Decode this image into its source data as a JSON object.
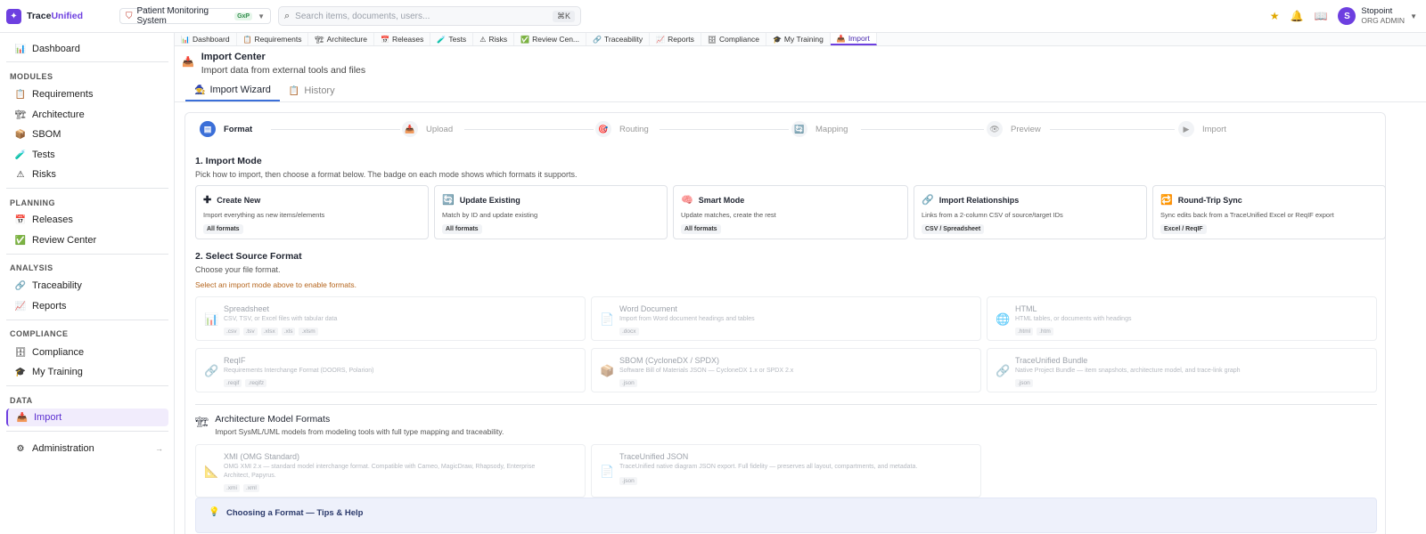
{
  "app": {
    "brand_prefix": "Trace",
    "brand_suffix": "Unified",
    "project": "Patient Monitoring System",
    "project_badge": "GxP",
    "search_placeholder": "Search items, documents, users...",
    "search_shortcut": "⌘K",
    "user_initial": "S",
    "user_name": "Stopoint",
    "user_role": "ORG ADMIN"
  },
  "sidebar": {
    "dashboard": "Dashboard",
    "sections": {
      "modules": "MODULES",
      "planning": "PLANNING",
      "analysis": "ANALYSIS",
      "compliance": "COMPLIANCE",
      "data": "DATA"
    },
    "items": {
      "requirements": "Requirements",
      "architecture": "Architecture",
      "sbom": "SBOM",
      "tests": "Tests",
      "risks": "Risks",
      "releases": "Releases",
      "review_center": "Review Center",
      "traceability": "Traceability",
      "reports": "Reports",
      "compliance": "Compliance",
      "my_training": "My Training",
      "import": "Import",
      "administration": "Administration"
    }
  },
  "tabs": [
    "Dashboard",
    "Requirements",
    "Architecture",
    "Releases",
    "Tests",
    "Risks",
    "Review Cen...",
    "Traceability",
    "Reports",
    "Compliance",
    "My Training",
    "Import"
  ],
  "page": {
    "title": "Import Center",
    "subtitle": "Import data from external tools and files",
    "subtabs": {
      "wizard": "Import Wizard",
      "history": "History"
    }
  },
  "stepper": [
    "Format",
    "Upload",
    "Routing",
    "Mapping",
    "Preview",
    "Import"
  ],
  "mode_section": {
    "title": "1. Import Mode",
    "subtitle": "Pick how to import, then choose a format below. The badge on each mode shows which formats it supports."
  },
  "modes": [
    {
      "title": "Create New",
      "desc": "Import everything as new items/elements",
      "badge": "All formats"
    },
    {
      "title": "Update Existing",
      "desc": "Match by ID and update existing",
      "badge": "All formats"
    },
    {
      "title": "Smart Mode",
      "desc": "Update matches, create the rest",
      "badge": "All formats"
    },
    {
      "title": "Import Relationships",
      "desc": "Links from a 2-column CSV of source/target IDs",
      "badge": "CSV / Spreadsheet"
    },
    {
      "title": "Round-Trip Sync",
      "desc": "Sync edits back from a TraceUnified Excel or ReqIF export",
      "badge": "Excel / ReqIF"
    }
  ],
  "format_section": {
    "title": "2. Select Source Format",
    "subtitle": "Choose your file format.",
    "warning": "Select an import mode above to enable formats."
  },
  "formats": [
    {
      "title": "Spreadsheet",
      "desc": "CSV, TSV, or Excel files with tabular data",
      "exts": [
        ".csv",
        ".tsv",
        ".xlsx",
        ".xls",
        ".xlsm"
      ]
    },
    {
      "title": "Word Document",
      "desc": "Import from Word document headings and tables",
      "exts": [
        ".docx"
      ]
    },
    {
      "title": "HTML",
      "desc": "HTML tables, or documents with headings",
      "exts": [
        ".html",
        ".htm"
      ]
    },
    {
      "title": "ReqIF",
      "desc": "Requirements Interchange Format (DOORS, Polarion)",
      "exts": [
        ".reqif",
        ".reqifz"
      ]
    },
    {
      "title": "SBOM (CycloneDX / SPDX)",
      "desc": "Software Bill of Materials JSON — CycloneDX 1.x or SPDX 2.x",
      "exts": [
        ".json"
      ]
    },
    {
      "title": "TraceUnified Bundle",
      "desc": "Native Project Bundle — item snapshots, architecture model, and trace-link graph",
      "exts": [
        ".json"
      ]
    }
  ],
  "arch_section": {
    "title": "Architecture Model Formats",
    "subtitle": "Import SysML/UML models from modeling tools with full type mapping and traceability."
  },
  "arch_formats": [
    {
      "title": "XMI (OMG Standard)",
      "desc1": "OMG XMI 2.x — standard model interchange format. Compatible with Cameo, MagicDraw, Rhapsody, Enterprise",
      "desc2": "Architect, Papyrus.",
      "exts": [
        ".xmi",
        ".xml"
      ]
    },
    {
      "title": "TraceUnified JSON",
      "desc1": "TraceUnified native diagram JSON export. Full fidelity — preserves all layout, compartments, and metadata.",
      "exts": [
        ".json"
      ]
    }
  ],
  "tips": {
    "title": "Choosing a Format — Tips & Help"
  }
}
